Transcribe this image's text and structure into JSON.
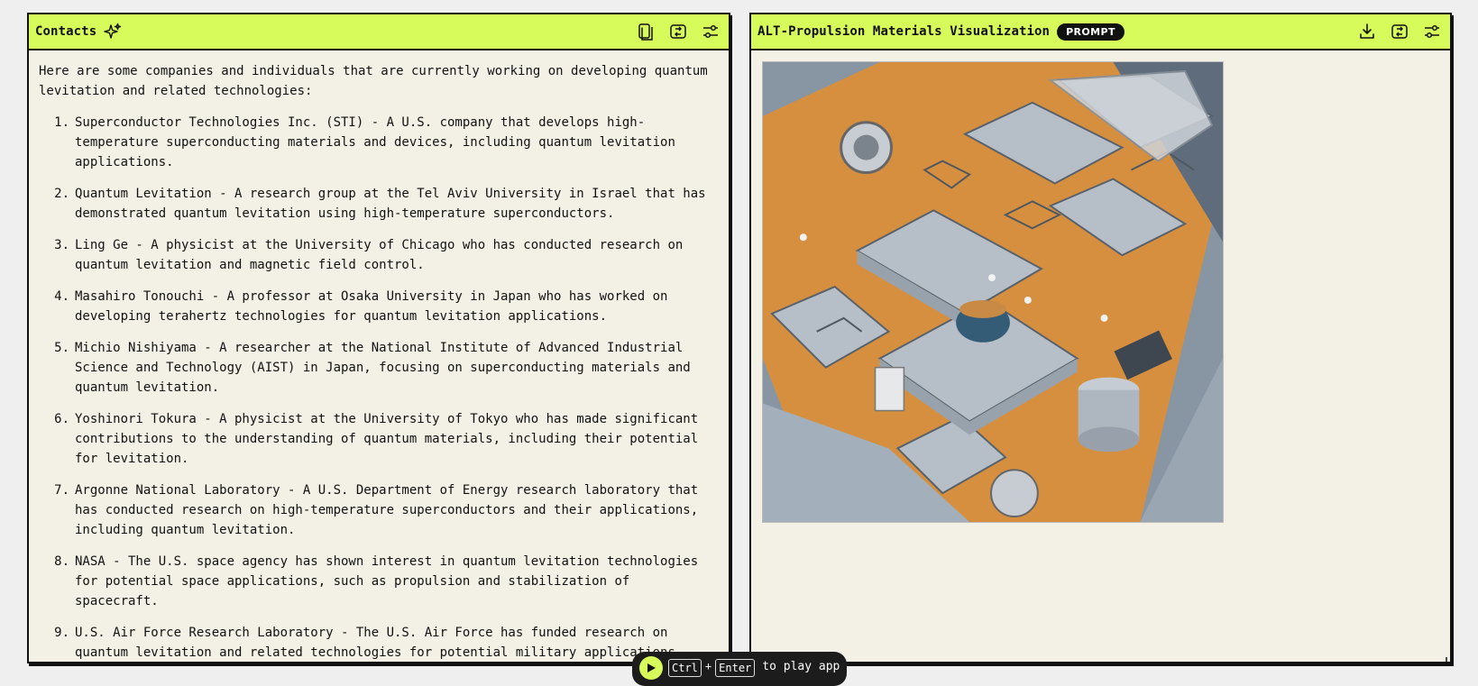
{
  "left_panel": {
    "title": "Contacts",
    "intro": "Here are some companies and individuals that are currently working on developing quantum levitation and related technologies:",
    "items": [
      {
        "num": "1.",
        "text": "Superconductor Technologies Inc. (STI) - A U.S. company that develops high-temperature superconducting materials and devices, including quantum levitation applications."
      },
      {
        "num": "2.",
        "text": "Quantum Levitation - A research group at the Tel Aviv University in Israel that has demonstrated quantum levitation using high-temperature superconductors."
      },
      {
        "num": "3.",
        "text": "Ling Ge - A physicist at the University of Chicago who has conducted research on quantum levitation and magnetic field control."
      },
      {
        "num": "4.",
        "text": "Masahiro Tonouchi - A professor at Osaka University in Japan who has worked on developing terahertz technologies for quantum levitation applications."
      },
      {
        "num": "5.",
        "text": "Michio Nishiyama - A researcher at the National Institute of Advanced Industrial Science and Technology (AIST) in Japan, focusing on superconducting materials and quantum levitation."
      },
      {
        "num": "6.",
        "text": "Yoshinori Tokura - A physicist at the University of Tokyo who has made significant contributions to the understanding of quantum materials, including their potential for levitation."
      },
      {
        "num": "7.",
        "text": "Argonne National Laboratory - A U.S. Department of Energy research laboratory that has conducted research on high-temperature superconductors and their applications, including quantum levitation."
      },
      {
        "num": "8.",
        "text": "NASA - The U.S. space agency has shown interest in quantum levitation technologies for potential space applications, such as propulsion and stabilization of spacecraft."
      },
      {
        "num": "9.",
        "text": "U.S. Air Force Research Laboratory - The U.S. Air Force has funded research on quantum levitation and related technologies for potential military applications."
      }
    ]
  },
  "right_panel": {
    "title": "ALT-Propulsion Materials Visualization",
    "badge": "PROMPT"
  },
  "play_bar": {
    "key1": "Ctrl",
    "plus": "+",
    "key2": "Enter",
    "text": "to play app"
  },
  "colors": {
    "header_bg": "#d6fb5a",
    "panel_bg": "#f3f1e6",
    "border": "#111111",
    "badge_bg": "#111111",
    "play_bar_bg": "#1c1c1c"
  },
  "icons": {
    "left_header": [
      "sparkle-icon",
      "copy-icon",
      "refresh-icon",
      "sliders-icon"
    ],
    "right_header": [
      "download-icon",
      "refresh-icon",
      "sliders-icon"
    ],
    "play": "play-icon"
  }
}
